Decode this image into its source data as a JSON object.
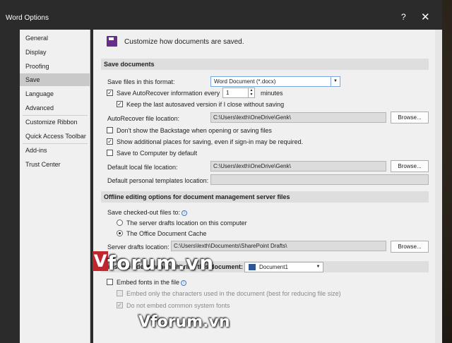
{
  "window": {
    "title": "Word Options",
    "help": "?",
    "close": "✕"
  },
  "nav": {
    "items": [
      "General",
      "Display",
      "Proofing",
      "Save",
      "Language",
      "Advanced",
      "Customize Ribbon",
      "Quick Access Toolbar",
      "Add-ins",
      "Trust Center"
    ],
    "active": "Save"
  },
  "header": {
    "text": "Customize how documents are saved."
  },
  "save_documents": {
    "heading": "Save documents",
    "format_label": "Save files in this format:",
    "format_value": "Word Document (*.docx)",
    "autorecover_label_pre": "Save AutoRecover information every",
    "autorecover_value": "1",
    "autorecover_unit": "minutes",
    "keep_last_label": "Keep the last autosaved version if I close without saving",
    "autorecover_location_label": "AutoRecover file location:",
    "autorecover_location_value": "C:\\Users\\lexth\\OneDrive\\Genk\\",
    "browse": "Browse...",
    "backstage_label": "Don't show the Backstage when opening or saving files",
    "additional_places_label": "Show additional places for saving, even if sign-in may be required.",
    "save_to_computer_label": "Save to Computer by default",
    "default_local_label": "Default local file location:",
    "default_local_value": "C:\\Users\\lexth\\OneDrive\\Genk\\",
    "personal_templates_label": "Default personal templates location:",
    "personal_templates_value": ""
  },
  "offline": {
    "heading": "Offline editing options for document management server files",
    "checked_out_label": "Save checked-out files to:",
    "opt_server": "The server drafts location on this computer",
    "opt_office": "The Office Document Cache",
    "server_drafts_label": "Server drafts location:",
    "server_drafts_value": "C:\\Users\\lexth\\Documents\\SharePoint Drafts\\",
    "browse": "Browse..."
  },
  "fidelity": {
    "heading": "Preserve fidelity when sharing this document:",
    "doc_value": "Document1",
    "embed_fonts": "Embed fonts in the file",
    "embed_only_chars": "Embed only the characters used in the document (best for reducing file size)",
    "no_common_fonts": "Do not embed common system fonts"
  },
  "watermark": {
    "logo_letter": "V",
    "text_main": "forum.vn",
    "text_second": "Vforum.vn"
  }
}
